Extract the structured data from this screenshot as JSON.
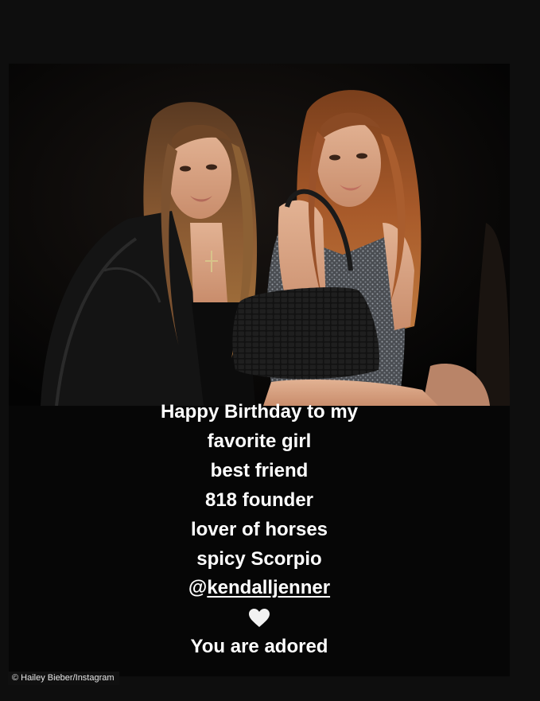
{
  "caption": {
    "line1": "Happy Birthday to my",
    "line2": "favorite girl",
    "line3": "best friend",
    "line4": "818 founder",
    "line5": "lover of horses",
    "line6": "spicy Scorpio",
    "mention_prefix": "@",
    "mention_handle": "kendalljenner",
    "heart_icon": "white-heart-icon",
    "line9": "You are adored"
  },
  "credit": "© Hailey Bieber/Instagram",
  "colors": {
    "background": "#0e0e0e",
    "caption_text": "#ffffff",
    "heart": "#f2f2f2"
  }
}
